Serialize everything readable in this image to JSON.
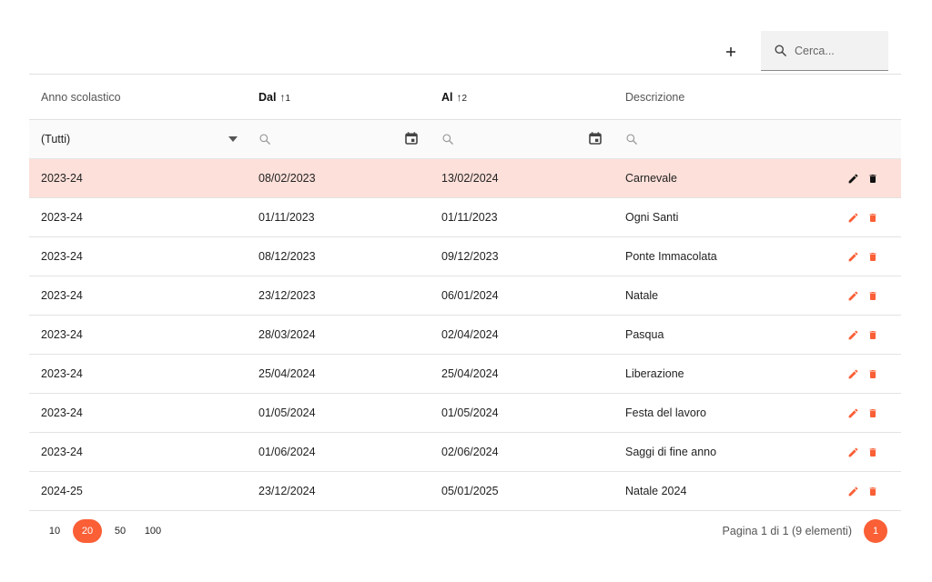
{
  "toolbar": {
    "add_label": "+",
    "search_placeholder": "Cerca..."
  },
  "columns": {
    "anno": "Anno scolastico",
    "dal": "Dal",
    "dal_sort_arrow": "↑",
    "dal_sort_index": "1",
    "al": "Al",
    "al_sort_arrow": "↑",
    "al_sort_index": "2",
    "descrizione": "Descrizione"
  },
  "filters": {
    "anno_value": "(Tutti)"
  },
  "rows": [
    {
      "anno": "2023-24",
      "dal": "08/02/2023",
      "al": "13/02/2024",
      "descrizione": "Carnevale"
    },
    {
      "anno": "2023-24",
      "dal": "01/11/2023",
      "al": "01/11/2023",
      "descrizione": "Ogni Santi"
    },
    {
      "anno": "2023-24",
      "dal": "08/12/2023",
      "al": "09/12/2023",
      "descrizione": "Ponte Immacolata"
    },
    {
      "anno": "2023-24",
      "dal": "23/12/2023",
      "al": "06/01/2024",
      "descrizione": "Natale"
    },
    {
      "anno": "2023-24",
      "dal": "28/03/2024",
      "al": "02/04/2024",
      "descrizione": "Pasqua"
    },
    {
      "anno": "2023-24",
      "dal": "25/04/2024",
      "al": "25/04/2024",
      "descrizione": "Liberazione"
    },
    {
      "anno": "2023-24",
      "dal": "01/05/2024",
      "al": "01/05/2024",
      "descrizione": "Festa del lavoro"
    },
    {
      "anno": "2023-24",
      "dal": "01/06/2024",
      "al": "02/06/2024",
      "descrizione": "Saggi di fine anno"
    },
    {
      "anno": "2024-25",
      "dal": "23/12/2024",
      "al": "05/01/2025",
      "descrizione": "Natale 2024"
    }
  ],
  "selected_row_index": 0,
  "pager": {
    "sizes": [
      "10",
      "20",
      "50",
      "100"
    ],
    "active_size": "20",
    "info": "Pagina 1 di 1 (9 elementi)",
    "current_page": "1"
  },
  "colors": {
    "accent": "#fa5f36",
    "selected_row": "#fde0d9",
    "selected_icon": "#111111"
  },
  "icons": {
    "add": "plus-icon",
    "search": "search-icon",
    "dropdown": "caret-down-icon",
    "calendar": "calendar-icon",
    "edit": "pencil-icon",
    "delete": "trash-icon"
  }
}
